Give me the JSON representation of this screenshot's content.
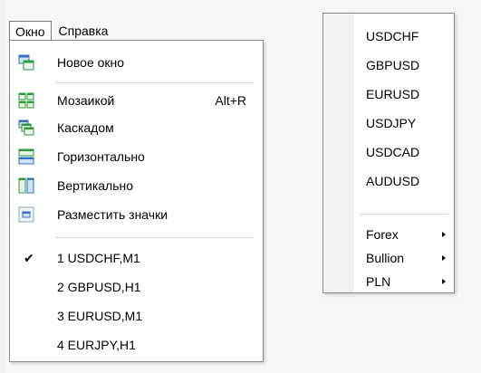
{
  "menubar": {
    "window_label": "Окно",
    "help_label": "Справка"
  },
  "window_menu": {
    "new_window": "Новое окно",
    "tile": "Мозаикой",
    "tile_shortcut": "Alt+R",
    "cascade": "Каскадом",
    "horizontal": "Горизонтально",
    "vertical": "Вертикально",
    "arrange_icons": "Разместить значки",
    "windows": [
      {
        "label": "1 USDCHF,M1",
        "checked": true
      },
      {
        "label": "2 GBPUSD,H1",
        "checked": false
      },
      {
        "label": "3 EURUSD,M1",
        "checked": false
      },
      {
        "label": "4 EURJPY,H1",
        "checked": false
      }
    ],
    "check_mark": "✔"
  },
  "symbols_menu": {
    "symbols": [
      "USDCHF",
      "GBPUSD",
      "EURUSD",
      "USDJPY",
      "USDCAD",
      "AUDUSD"
    ],
    "groups": [
      "Forex",
      "Bullion",
      "PLN"
    ]
  },
  "colors": {
    "icon_green": "#2e9a3a",
    "icon_blue": "#3a6fc4",
    "icon_light": "#cfe3f7"
  }
}
